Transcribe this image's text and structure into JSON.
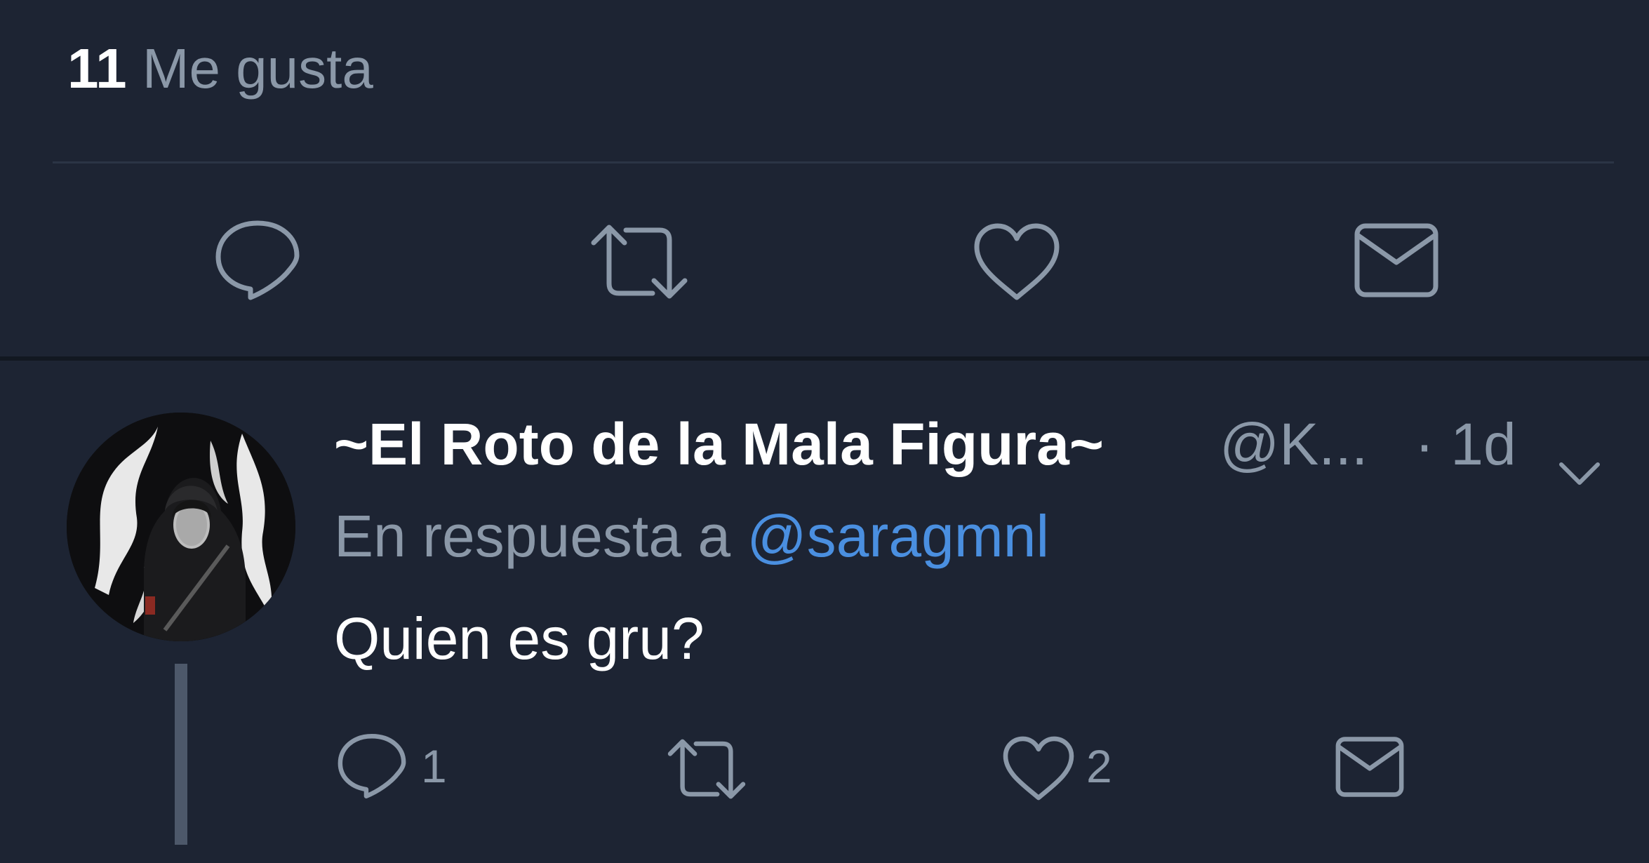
{
  "focused_tweet": {
    "likes_count": "11",
    "likes_label": "Me gusta"
  },
  "reply": {
    "display_name": "~El Roto de la Mala Figura~",
    "handle": "@K...",
    "time": "· 1d",
    "reply_to_prefix": "En respuesta a",
    "reply_to_mention": "@saragmnl",
    "text": "Quien es gru?",
    "reply_count": "1",
    "like_count": "2"
  },
  "icons": {
    "reply": "reply-icon",
    "retweet": "retweet-icon",
    "like": "heart-icon",
    "message": "mail-icon",
    "menu": "chevron-down-icon"
  },
  "colors": {
    "background": "#1d2433",
    "muted_text": "#8b98a8",
    "mention": "#4a8fe0"
  }
}
